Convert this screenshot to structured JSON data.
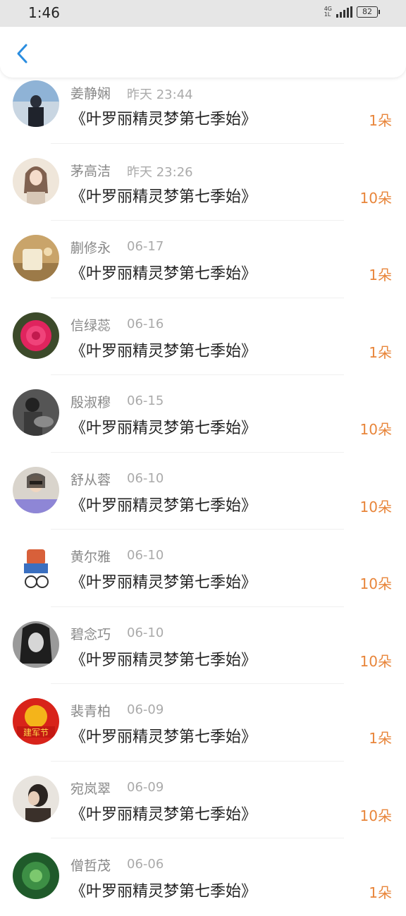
{
  "status_bar": {
    "time": "1:46",
    "network_top": "4G",
    "network_bottom": "1L",
    "battery": "82"
  },
  "nav": {
    "back_icon": "chevron-left-icon",
    "accent_color": "#2a8de0"
  },
  "colors": {
    "amount": "#e8853a",
    "name": "#888888",
    "title": "#222222"
  },
  "list": [
    {
      "name": "姜静娴",
      "time": "昨天 23:44",
      "title": "《叶罗丽精灵梦第七季始》",
      "amount": "1朵"
    },
    {
      "name": "茅高洁",
      "time": "昨天 23:26",
      "title": "《叶罗丽精灵梦第七季始》",
      "amount": "10朵"
    },
    {
      "name": "蒯修永",
      "time": "06-17",
      "title": "《叶罗丽精灵梦第七季始》",
      "amount": "1朵"
    },
    {
      "name": "信绿蕊",
      "time": "06-16",
      "title": "《叶罗丽精灵梦第七季始》",
      "amount": "1朵"
    },
    {
      "name": "殷淑穆",
      "time": "06-15",
      "title": "《叶罗丽精灵梦第七季始》",
      "amount": "10朵"
    },
    {
      "name": "舒从蓉",
      "time": "06-10",
      "title": "《叶罗丽精灵梦第七季始》",
      "amount": "10朵"
    },
    {
      "name": "黄尔雅",
      "time": "06-10",
      "title": "《叶罗丽精灵梦第七季始》",
      "amount": "10朵"
    },
    {
      "name": "碧念巧",
      "time": "06-10",
      "title": "《叶罗丽精灵梦第七季始》",
      "amount": "10朵"
    },
    {
      "name": "裴青柏",
      "time": "06-09",
      "title": "《叶罗丽精灵梦第七季始》",
      "amount": "1朵"
    },
    {
      "name": "宛岚翠",
      "time": "06-09",
      "title": "《叶罗丽精灵梦第七季始》",
      "amount": "10朵"
    },
    {
      "name": "僧哲茂",
      "time": "06-06",
      "title": "《叶罗丽精灵梦第七季始》",
      "amount": "1朵"
    }
  ]
}
